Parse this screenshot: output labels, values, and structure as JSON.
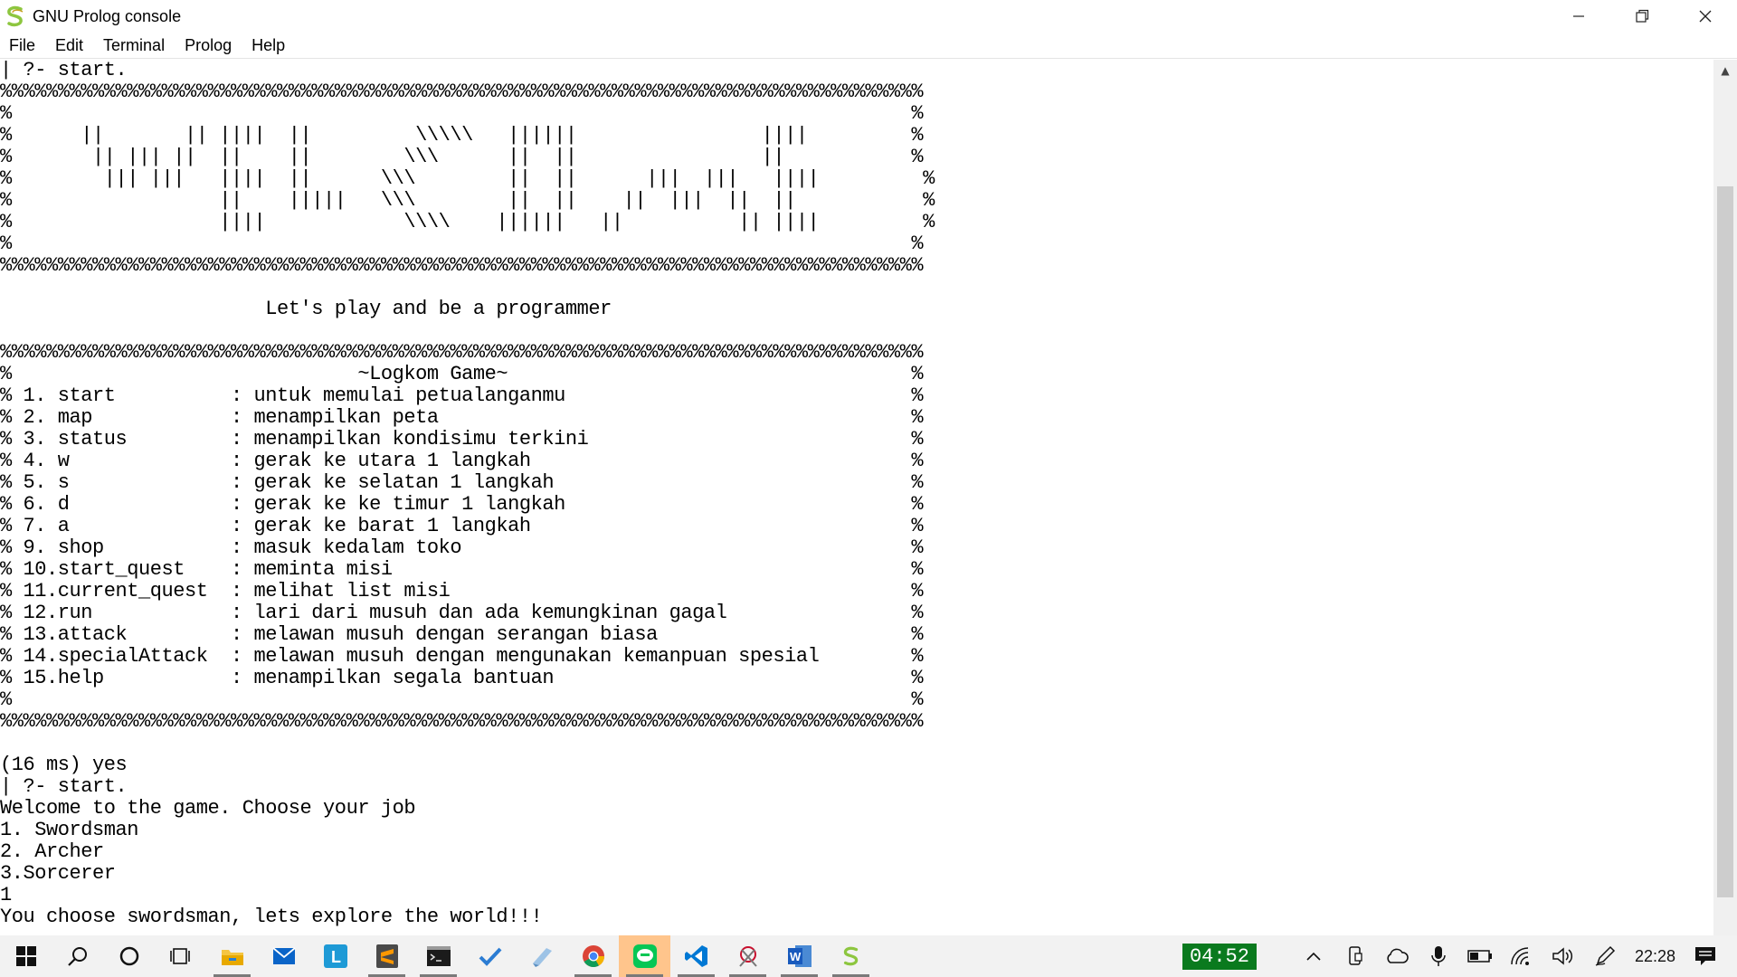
{
  "window": {
    "title": "GNU Prolog console"
  },
  "menu": [
    "File",
    "Edit",
    "Terminal",
    "Prolog",
    "Help"
  ],
  "console_lines": [
    "| ?- start.",
    "%%%%%%%%%%%%%%%%%%%%%%%%%%%%%%%%%%%%%%%%%%%%%%%%%%%%%%%%%%%%%%%%%%%%%%%%%%%%%%%%",
    "%                                                                              %",
    "%      ||       || ||||  ||         \\\\\\\\\\   ||||||                ||||         %",
    "%       || ||| ||  ||    ||        \\\\\\      ||  ||                ||           %",
    "%        ||| |||   ||||  ||      \\\\\\        ||  ||      |||  |||   ||||         %",
    "%                  ||    |||||   \\\\\\        ||  ||    ||  |||  ||  ||           %",
    "%                  ||||            \\\\\\\\    ||||||   ||          || ||||         %",
    "%                                                                              %",
    "%%%%%%%%%%%%%%%%%%%%%%%%%%%%%%%%%%%%%%%%%%%%%%%%%%%%%%%%%%%%%%%%%%%%%%%%%%%%%%%%",
    "",
    "                       Let's play and be a programmer",
    "",
    "%%%%%%%%%%%%%%%%%%%%%%%%%%%%%%%%%%%%%%%%%%%%%%%%%%%%%%%%%%%%%%%%%%%%%%%%%%%%%%%%",
    "%                              ~Logkom Game~                                   %",
    "% 1. start          : untuk memulai petualanganmu                              %",
    "% 2. map            : menampilkan peta                                         %",
    "% 3. status         : menampilkan kondisimu terkini                            %",
    "% 4. w              : gerak ke utara 1 langkah                                 %",
    "% 5. s              : gerak ke selatan 1 langkah                               %",
    "% 6. d              : gerak ke ke timur 1 langkah                              %",
    "% 7. a              : gerak ke barat 1 langkah                                 %",
    "% 9. shop           : masuk kedalam toko                                       %",
    "% 10.start_quest    : meminta misi                                             %",
    "% 11.current_quest  : melihat list misi                                        %",
    "% 12.run            : lari dari musuh dan ada kemungkinan gagal                %",
    "% 13.attack         : melawan musuh dengan serangan biasa                      %",
    "% 14.specialAttack  : melawan musuh dengan mengunakan kemanpuan spesial        %",
    "% 15.help           : menampilkan segala bantuan                               %",
    "%                                                                              %",
    "%%%%%%%%%%%%%%%%%%%%%%%%%%%%%%%%%%%%%%%%%%%%%%%%%%%%%%%%%%%%%%%%%%%%%%%%%%%%%%%%",
    "",
    "(16 ms) yes",
    "| ?- start.",
    "Welcome to the game. Choose your job",
    "1. Swordsman",
    "2. Archer",
    "3.Sorcerer",
    "1",
    "You choose swordsman, lets explore the world!!!"
  ],
  "taskbar": {
    "timer": "04:52",
    "clock": "22:28",
    "apps": [
      {
        "icon": "file-explorer-icon"
      },
      {
        "icon": "mail-icon"
      },
      {
        "icon": "l-app-icon"
      },
      {
        "icon": "sublime-text-icon"
      },
      {
        "icon": "terminal-icon"
      },
      {
        "icon": "todo-check-icon"
      },
      {
        "icon": "paint-icon"
      },
      {
        "icon": "chrome-icon"
      },
      {
        "icon": "line-chat-icon"
      },
      {
        "icon": "vscode-icon"
      },
      {
        "icon": "snipping-tool-icon"
      },
      {
        "icon": "word-icon"
      },
      {
        "icon": "gnu-prolog-icon"
      }
    ]
  },
  "colors": {
    "accent_active": "#ffc58c",
    "timer_bg": "#0a7a1e",
    "prolog_icon": "#8dc63f"
  }
}
